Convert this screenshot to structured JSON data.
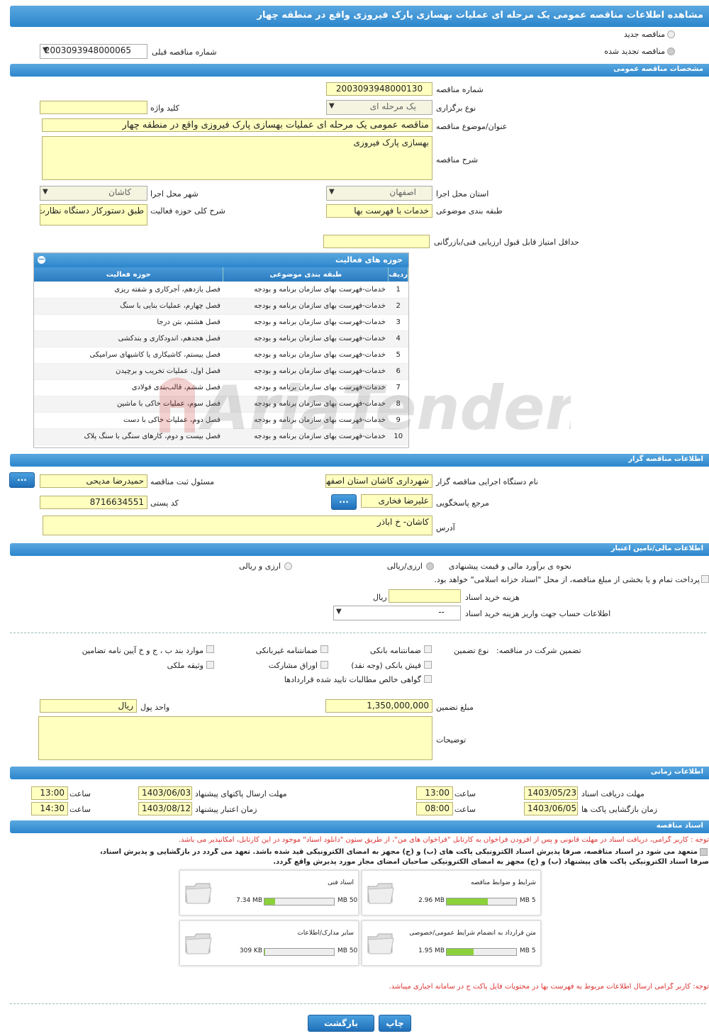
{
  "title": "مشاهده اطلاعات مناقصه عمومی یک مرحله ای عملیات بهسازی پارک فیروزی واقع در منطقه چهار",
  "top": {
    "new_label": "مناقصه جدید",
    "renew_label": "مناقصه تجدید شده",
    "prev_label": "شماره مناقصه قبلی",
    "prev_value": "2003093948000065"
  },
  "general": {
    "header": "مشخصات مناقصه عمومی",
    "number_label": "شماره مناقصه",
    "number": "2003093948000130",
    "type_label": "نوع برگزاری",
    "type": "یک مرحله ای",
    "keyword_label": "کلید واژه",
    "keyword": "",
    "subject_label": "عنوان/موضوع مناقصه",
    "subject": "مناقصه عمومی یک مرحله ای عملیات بهسازی پارک فیروزی واقع در منطقه چهار",
    "desc_label": "شرح مناقصه",
    "desc": "بهسازی پارک فیروزی",
    "province_label": "استان محل اجرا",
    "province": "اصفهان",
    "city_label": "شهر محل اجرا",
    "city": "کاشان",
    "cat_label": "طبقه بندی موضوعی",
    "cat": "خدمات با فهرست بها",
    "scope_label": "شرح کلی حوزه فعالیت",
    "scope": "طبق دستورکار دستگاه نظارت",
    "min_label": "حداقل امتیاز قابل قبول ارزیابی فنی/بازرگانی",
    "min": ""
  },
  "activities": {
    "header": "حوزه های فعالیت",
    "col_row": "ردیف",
    "col_cat": "طبقه بندی موضوعی",
    "col_field": "حوزه فعالیت",
    "rows": [
      [
        "1",
        "خدمات-فهرست بهای سازمان برنامه و بودجه",
        "فصل یازدهم، آجرکاری و شفته ریزی"
      ],
      [
        "2",
        "خدمات-فهرست بهای سازمان برنامه و بودجه",
        "فصل چهارم، عملیات بنایی با سنگ"
      ],
      [
        "3",
        "خدمات-فهرست بهای سازمان برنامه و بودجه",
        "فصل هشتم، بتن درجا"
      ],
      [
        "4",
        "خدمات-فهرست بهای سازمان برنامه و بودجه",
        "فصل هجدهم، اندودکاری و بندکشی"
      ],
      [
        "5",
        "خدمات-فهرست بهای سازمان برنامه و بودجه",
        "فصل بیستم، کاشیکاری یا کاشیهای سرامیکی"
      ],
      [
        "6",
        "خدمات-فهرست بهای سازمان برنامه و بودجه",
        "فصل اول، عملیات تخریب و برچیدن"
      ],
      [
        "7",
        "خدمات-فهرست بهای سازمان برنامه و بودجه",
        "فصل ششم، قالب‌بندی فولادی"
      ],
      [
        "8",
        "خدمات-فهرست بهای سازمان برنامه و بودجه",
        "فصل سوم، عملیات خاکی با ماشین"
      ],
      [
        "9",
        "خدمات-فهرست بهای سازمان برنامه و بودجه",
        "فصل دوم، عملیات خاکی با دست"
      ],
      [
        "10",
        "خدمات-فهرست بهای سازمان برنامه و بودجه",
        "فصل بیست و دوم، کارهای سنگی با سنگ پلاک"
      ]
    ]
  },
  "org": {
    "header": "اطلاعات مناقصه گزار",
    "name_label": "نام دستگاه اجرایی مناقصه گزار",
    "name": "شهرداری کاشان استان اصفهان",
    "resp_label": "مسئول ثبت مناقصه",
    "resp": "حمیدرضا مدیحی",
    "ref_label": "مرجع پاسخگویی",
    "ref": "علیرضا فخاری",
    "postal_label": "کد پستی",
    "postal": "8716634551",
    "addr_label": "آدرس",
    "addr": "کاشان- خ اباذر",
    "dots": "..."
  },
  "finance": {
    "header": "اطلاعات مالی/تامین اعتبار",
    "method_label": "نحوه ی برآورد مالی و قیمت پیشنهادی",
    "opt1": "ارزی/ریالی",
    "opt2": "ارزی و ریالی",
    "treasury": "پرداخت تمام و یا بخشی از مبلغ مناقصه، از محل \"اسناد خزانه اسلامی\" خواهد بود.",
    "fee_label": "هزینه خرید اسناد",
    "fee_unit": "ریال",
    "account_label": "اطلاعات حساب جهت واریز هزینه خرید اسناد",
    "account": "--"
  },
  "guarantee": {
    "label": "تضمین شرکت در مناقصه:",
    "type_label": "نوع تضمین",
    "c1": "ضمانتنامه بانکی",
    "c2": "ضمانتنامه غیربانکی",
    "c3": "موارد بند ب ، ج و خ آیین نامه تضامین",
    "c4": "فیش بانکی (وجه نقد)",
    "c5": "اوراق مشارکت",
    "c6": "وثیقه ملکی",
    "c7": "گواهی خالص مطالبات تایید شده قراردادها",
    "amount_label": "مبلغ تضمین",
    "amount": "1,350,000,000",
    "currency_label": "واحد پول",
    "currency": "ریال",
    "notes_label": "توضیحات"
  },
  "time": {
    "header": "اطلاعات زمانی",
    "doc_label": "مهلت دریافت اسناد",
    "doc_date": "1403/05/23",
    "time_label": "ساعت",
    "doc_time": "13:00",
    "send_label": "مهلت ارسال پاکتهای پیشنهاد",
    "send_date": "1403/06/03",
    "send_time": "13:00",
    "open_label": "زمان بازگشایی پاکت ها",
    "open_date": "1403/06/05",
    "open_time": "08:00",
    "valid_label": "زمان اعتبار پیشنهاد",
    "valid_date": "1403/08/12",
    "valid_time": "14:30"
  },
  "docs": {
    "header": "اسناد مناقصه",
    "note1": "توجه : کاربر گرامی، دریافت اسناد در مهلت قانونی و پس از افزودن فراخوان به کارتابل \"فراخوان های من\"، از طریق ستون \"دانلود اسناد\" موجود در این کارتابل، امکانپذیر می باشد.",
    "commit1": "متعهد می شود در اسناد مناقصه، صرفاً پذیرش اسناد الکترونیکی پاکت های (ب) و (ج) مجهز به امضای الکترونیکی قید شده باشد. تعهد می گردد در بازگشایی و پذیرش اسناد،",
    "commit2": "صرفاً اسناد الکترونیکی پاکت های پیشنهاد (ب) و (ج) مجهز به امضای الکترونیکی صاحبان امضای مجاز مورد پذیرش واقع گردد.",
    "files": [
      {
        "name": "شرایط و ضوابط مناقصه",
        "size": "2.96 MB",
        "max": "5 MB",
        "pct": 0.59
      },
      {
        "name": "اسناد فنی",
        "size": "7.34 MB",
        "max": "50 MB",
        "pct": 0.15
      },
      {
        "name": "متن قرارداد به انضمام شرایط عمومی/خصوصی",
        "size": "1.95 MB",
        "max": "5 MB",
        "pct": 0.39
      },
      {
        "name": "سایر مدارک/اطلاعات",
        "size": "309 KB",
        "max": "50 MB",
        "pct": 0.01
      }
    ],
    "note2": "توجه: کاربر گرامی ارسال اطلاعات مربوط به فهرست بها در محتویات فایل پاکت ج در سامانه اجباری میباشد."
  },
  "buttons": {
    "print": "چاپ",
    "back": "بازگشت"
  },
  "watermark": "AriaTender.neT"
}
